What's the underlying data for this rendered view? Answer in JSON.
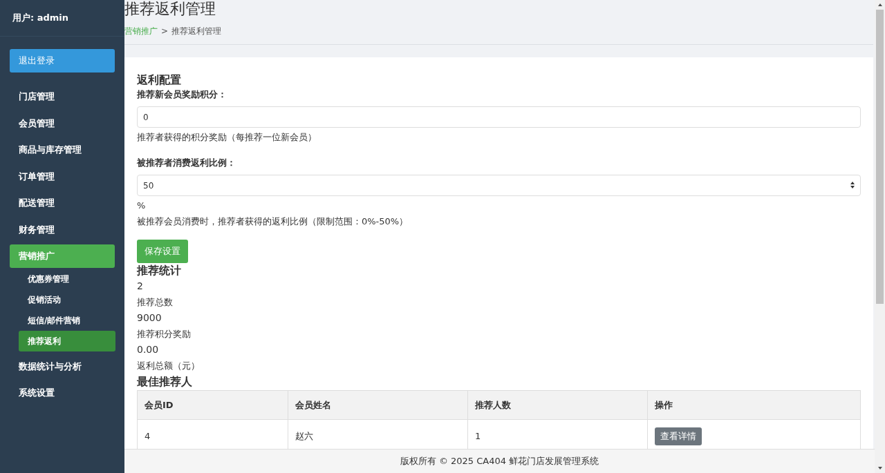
{
  "sidebar": {
    "user": "用户: admin",
    "logout": "退出登录",
    "items": [
      {
        "label": "门店管理",
        "selected": false
      },
      {
        "label": "会员管理",
        "selected": false
      },
      {
        "label": "商品与库存管理",
        "selected": false
      },
      {
        "label": "订单管理",
        "selected": false
      },
      {
        "label": "配送管理",
        "selected": false
      },
      {
        "label": "财务管理",
        "selected": false
      },
      {
        "label": "营销推广",
        "selected": true,
        "children": [
          {
            "label": "优惠券管理",
            "selected": false
          },
          {
            "label": "促销活动",
            "selected": false
          },
          {
            "label": "短信/邮件营销",
            "selected": false
          },
          {
            "label": "推荐返利",
            "selected": true
          }
        ]
      },
      {
        "label": "数据统计与分析",
        "selected": false
      },
      {
        "label": "系统设置",
        "selected": false
      }
    ]
  },
  "header": {
    "title": "推荐返利管理",
    "breadcrumb": [
      {
        "label": "营销推广",
        "link": true
      },
      {
        "label": ">",
        "link": false
      },
      {
        "label": "推荐返利管理",
        "link": false
      }
    ]
  },
  "config": {
    "title": "返利配置",
    "fields": [
      {
        "kind": "text",
        "label": "推荐新会员奖励积分：",
        "value": "0",
        "help": [
          "推荐者获得的积分奖励（每推荐一位新会员）"
        ]
      },
      {
        "kind": "number",
        "label": "被推荐者消费返利比例：",
        "value": "50",
        "help": [
          "%",
          "被推荐会员消费时，推荐者获得的返利比例（限制范围：0%-50%）"
        ]
      }
    ],
    "save": "保存设置"
  },
  "stats": {
    "title": "推荐统计",
    "items": [
      {
        "value": "2",
        "label": "推荐总数"
      },
      {
        "value": "9000",
        "label": "推荐积分奖励"
      },
      {
        "value": "0.00",
        "label": "返利总额（元）"
      }
    ]
  },
  "top": {
    "title": "最佳推荐人",
    "columns": [
      "会员ID",
      "会员姓名",
      "推荐人数",
      "操作"
    ],
    "rows": [
      {
        "cells": [
          "4",
          "赵六",
          "1"
        ],
        "action": "查看详情"
      }
    ]
  },
  "footer": "版权所有 © 2025 CA404 鲜花门店发展管理系统"
}
